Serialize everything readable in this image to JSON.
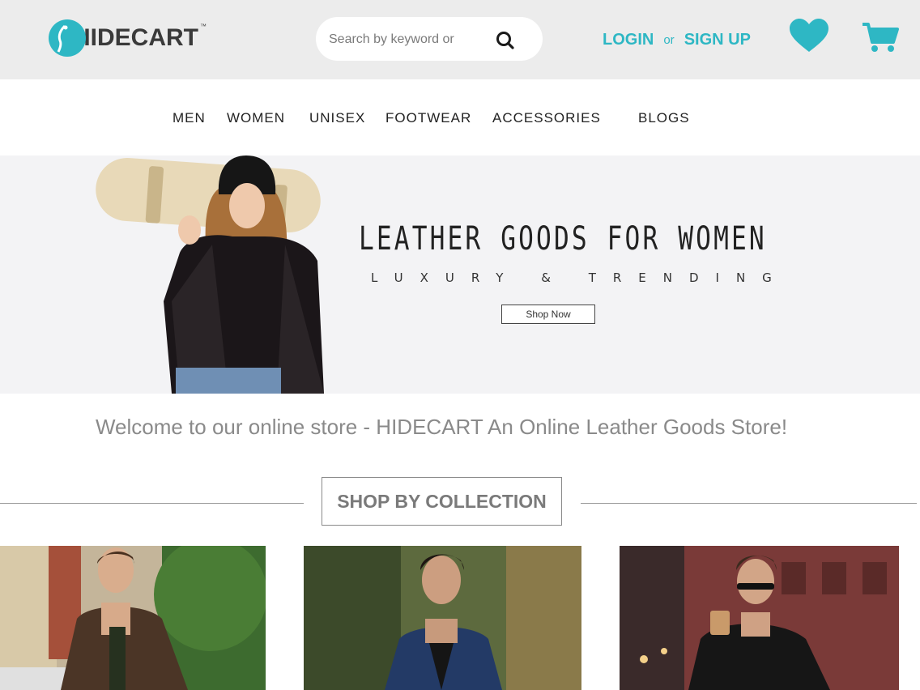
{
  "header": {
    "logo": {
      "brand": "HIDECART",
      "tm": "™"
    },
    "search": {
      "placeholder": "Search by keyword or"
    },
    "auth": {
      "login": "LOGIN",
      "or": "or",
      "signup": "SIGN UP"
    },
    "icons": {
      "wishlist": "heart-icon",
      "cart": "cart-icon",
      "search": "search-icon"
    }
  },
  "nav": {
    "items": [
      {
        "label": "MEN"
      },
      {
        "label": "WOMEN"
      },
      {
        "label": "UNISEX"
      },
      {
        "label": "FOOTWEAR"
      },
      {
        "label": "ACCESSORIES"
      },
      {
        "label": "BLOGS"
      }
    ]
  },
  "hero": {
    "title": "LEATHER GOODS FOR WOMEN",
    "subtitle": "LUXURY & TRENDING",
    "button": "Shop Now"
  },
  "welcome": "Welcome to our online store - HIDECART An Online Leather Goods Store!",
  "collection": {
    "heading": "SHOP BY COLLECTION"
  },
  "colors": {
    "accent": "#2eb7c4",
    "header_bg": "#ececec",
    "hero_bg": "#f3f3f5",
    "text_muted": "#8a8a8a"
  }
}
